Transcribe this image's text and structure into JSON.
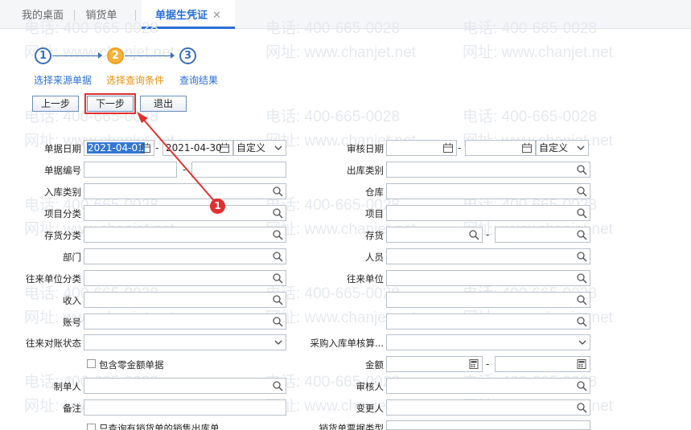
{
  "tabs": {
    "desktop": "我的桌面",
    "sales_order": "销货单",
    "generate_voucher": "单据生凭证",
    "close_glyph": "✕"
  },
  "watermark": {
    "phone": "电话: 400-665-0028",
    "site": "网址: www.chanjet.net"
  },
  "steps": {
    "n1": "1",
    "n2": "2",
    "n3": "3",
    "s1": "选择来源单据",
    "s2": "选择查询条件",
    "s3": "查询结果"
  },
  "buttons": {
    "prev": "上一步",
    "next": "下一步",
    "exit": "退出"
  },
  "annotation": {
    "badge": "1"
  },
  "form": {
    "doc_date": "单据日期",
    "doc_date_from": "2021-04-01",
    "doc_date_to": "2021-04-30",
    "doc_date_range": "自定义",
    "audit_date": "审核日期",
    "audit_date_range": "自定义",
    "doc_no": "单据编号",
    "outbound_type": "出库类别",
    "inbound_type": "入库类别",
    "warehouse": "仓库",
    "project_category": "项目分类",
    "project": "项目",
    "inventory_category": "存货分类",
    "inventory": "存货",
    "department": "部门",
    "staff": "人员",
    "partner_category": "往来单位分类",
    "partner": "往来单位",
    "income": "收入",
    "amount": "金额",
    "account_no": "账号",
    "reconcile_status": "往来对账状态",
    "purchase_inbound": "采购入库单核算...",
    "include_zero": "包含零金额单据",
    "maker": "制单人",
    "auditor": "审核人",
    "remark": "备注",
    "modifier": "变更人",
    "only_sales_outbound": "只查询有销货单的销售出库单",
    "sales_ticket_type": "销货单票据类型",
    "dash": "-"
  }
}
